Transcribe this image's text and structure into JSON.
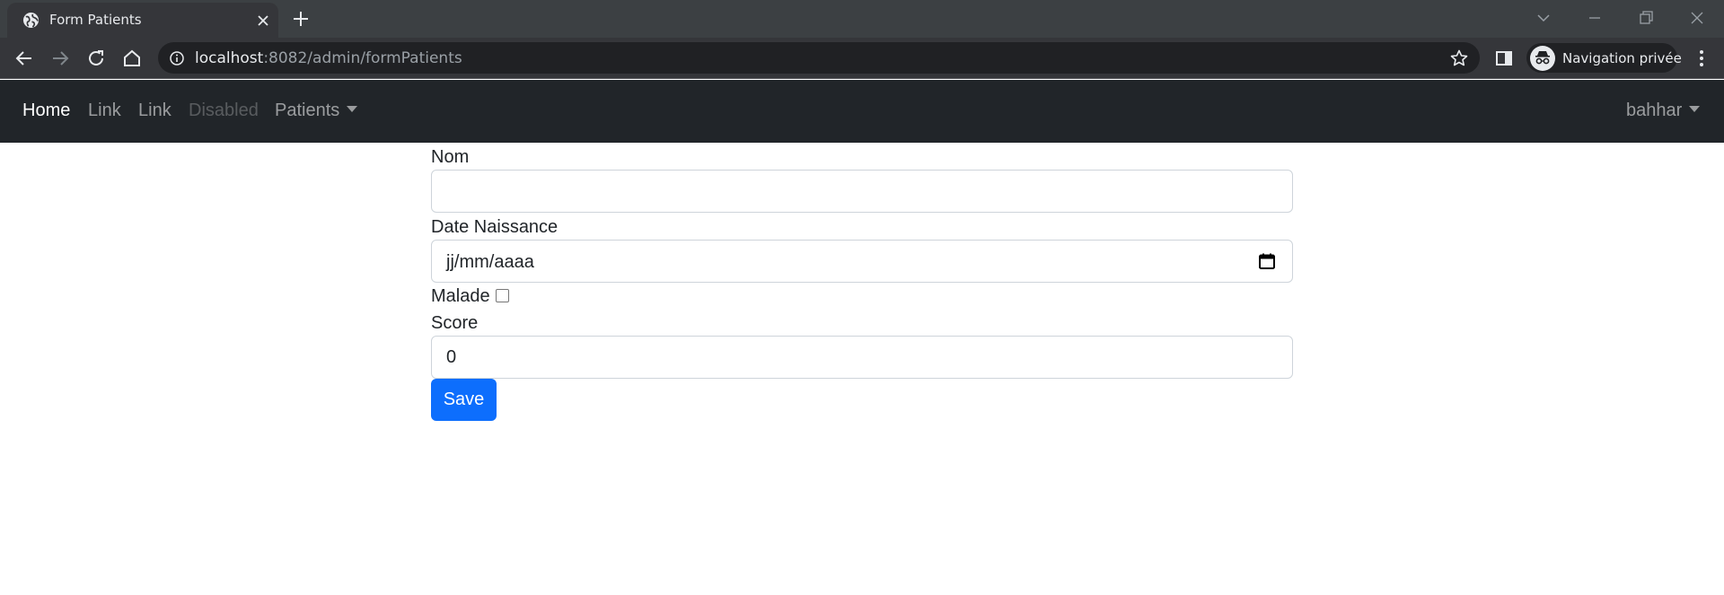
{
  "browser": {
    "tab": {
      "title": "Form Patients"
    },
    "address": {
      "host": "localhost",
      "path": ":8082/admin/formPatients"
    },
    "profile": {
      "label": "Navigation privée"
    }
  },
  "navbar": {
    "items": [
      {
        "label": "Home",
        "state": "active"
      },
      {
        "label": "Link",
        "state": "normal"
      },
      {
        "label": "Link",
        "state": "normal"
      },
      {
        "label": "Disabled",
        "state": "disabled"
      },
      {
        "label": "Patients",
        "state": "dropdown"
      }
    ],
    "user": {
      "label": "bahhar"
    }
  },
  "form": {
    "nom": {
      "label": "Nom",
      "value": ""
    },
    "date_naissance": {
      "label": "Date Naissance",
      "placeholder": "jj/mm/aaaa"
    },
    "malade": {
      "label": "Malade",
      "checked": false
    },
    "score": {
      "label": "Score",
      "value": "0"
    },
    "save_label": "Save"
  },
  "colors": {
    "chrome_bg": "#3c4043",
    "toolbar_bg": "#35363a",
    "navbar_bg": "#212529",
    "primary": "#0d6efd"
  }
}
